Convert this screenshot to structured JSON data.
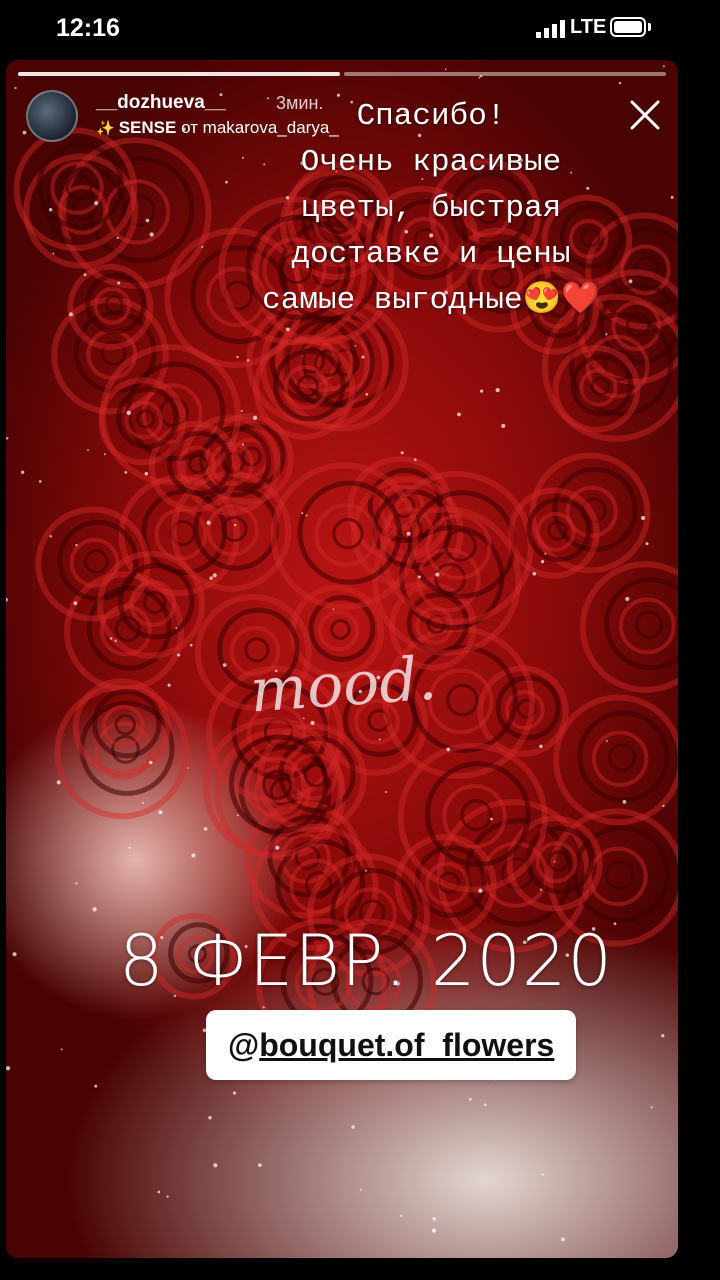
{
  "status_bar": {
    "time": "12:16",
    "network": "LTE"
  },
  "story": {
    "progress_segments": 2,
    "username": "__dozhueva__",
    "time_ago": "3мин.",
    "filter": {
      "name": "SENSE",
      "by": "от makarova_darya_"
    },
    "caption": "Спасибо!\nОчень красивые\nцветы, быстрая\nдоставке и цены\nсамые выгодные😍❤️",
    "overlay_text": "mood.",
    "date_sticker": "8 ФЕВР. 2020 Г.",
    "mention": {
      "at": "@",
      "handle": "bouquet.of_flowers"
    }
  },
  "colors": {
    "rose_red": "#b81414",
    "dark_red": "#4a0303",
    "mention_bg": "#ffffff"
  },
  "icons": [
    "signal-icon",
    "battery-icon",
    "sparkle-icon",
    "close-icon"
  ]
}
